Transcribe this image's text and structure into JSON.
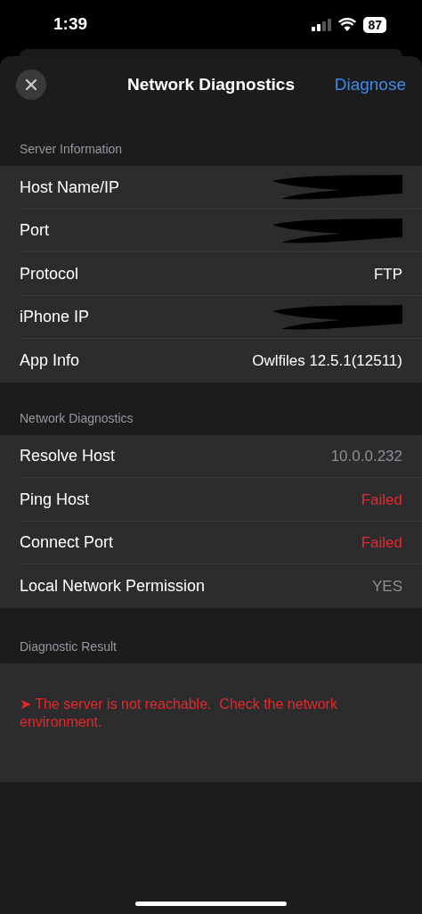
{
  "status_bar": {
    "time": "1:39",
    "battery": "87"
  },
  "header": {
    "title": "Network Diagnostics",
    "action": "Diagnose"
  },
  "sections": [
    {
      "title": "Server Information",
      "rows": [
        {
          "label": "Host Name/IP",
          "kind": "redacted"
        },
        {
          "label": "Port",
          "kind": "redacted"
        },
        {
          "label": "Protocol",
          "value": "FTP",
          "kind": "plain"
        },
        {
          "label": "iPhone IP",
          "kind": "redacted"
        },
        {
          "label": "App Info",
          "value": "Owlfiles 12.5.1(12511)",
          "kind": "plain"
        }
      ]
    },
    {
      "title": "Network Diagnostics",
      "rows": [
        {
          "label": "Resolve Host",
          "value": "10.0.0.232",
          "kind": "muted"
        },
        {
          "label": "Ping Host",
          "value": "Failed",
          "kind": "error"
        },
        {
          "label": "Connect Port",
          "value": "Failed",
          "kind": "error"
        },
        {
          "label": "Local Network Permission",
          "value": "YES",
          "kind": "muted"
        }
      ]
    }
  ],
  "result": {
    "title": "Diagnostic Result",
    "message": "➤ The server is not reachable.  Check the network environment."
  }
}
